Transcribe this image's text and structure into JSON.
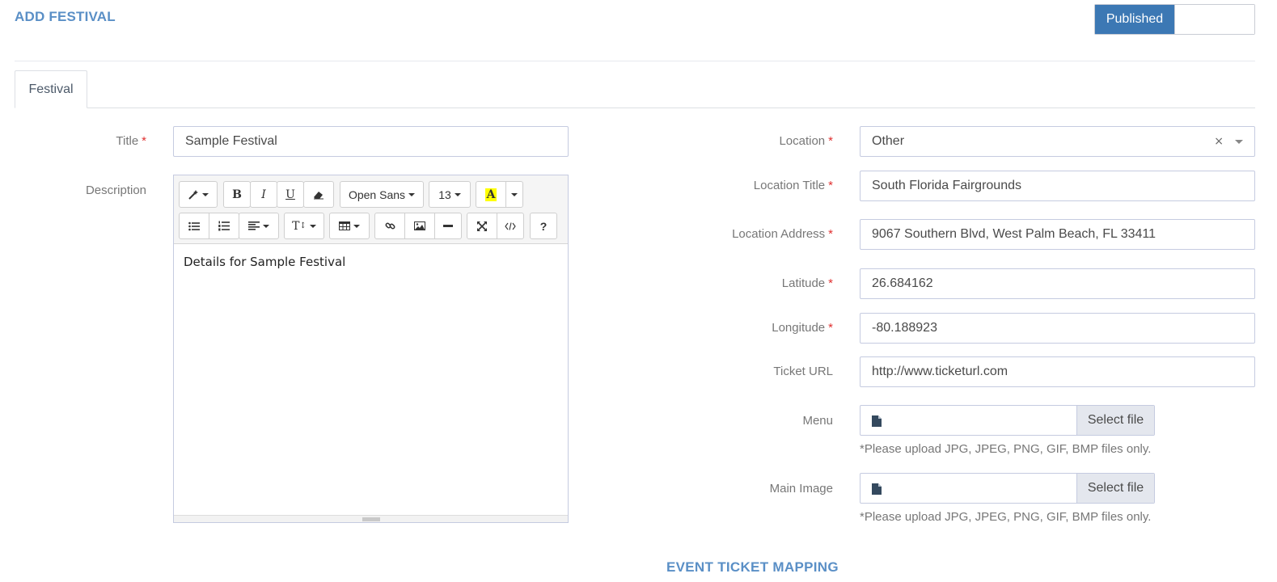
{
  "header": {
    "title": "ADD FESTIVAL"
  },
  "status_toggle": {
    "label": "Published",
    "accent": "#3c78b4"
  },
  "tabs": [
    {
      "label": "Festival"
    }
  ],
  "form": {
    "title": {
      "label": "Title",
      "required": "*",
      "value": "Sample Festival"
    },
    "description": {
      "label": "Description",
      "content": "Details for Sample Festival",
      "toolbar": {
        "font_family": "Open Sans",
        "font_size": "13",
        "bold": "B",
        "italic": "I",
        "underline": "U",
        "highlight": "A",
        "line_height": "T",
        "help": "?"
      }
    },
    "location": {
      "label": "Location",
      "required": "*",
      "value": "Other",
      "clear": "×"
    },
    "location_title": {
      "label": "Location Title",
      "required": "*",
      "value": "South Florida Fairgrounds"
    },
    "location_address": {
      "label": "Location Address",
      "required": "*",
      "value": "9067 Southern Blvd, West Palm Beach, FL 33411"
    },
    "latitude": {
      "label": "Latitude",
      "required": "*",
      "value": "26.684162"
    },
    "longitude": {
      "label": "Longitude",
      "required": "*",
      "value": "-80.188923"
    },
    "ticket_url": {
      "label": "Ticket URL",
      "value": "http://www.ticketurl.com"
    },
    "menu": {
      "label": "Menu",
      "button": "Select file",
      "hint": "*Please upload JPG, JPEG, PNG, GIF, BMP files only."
    },
    "main_image": {
      "label": "Main Image",
      "button": "Select file",
      "hint": "*Please upload JPG, JPEG, PNG, GIF, BMP files only."
    }
  },
  "sections": {
    "event_ticket_mapping": "EVENT TICKET MAPPING"
  },
  "colors": {
    "heading": "#5a8fc6",
    "required": "#e03030",
    "border": "#c5cbe0",
    "highlight_yellow": "#ffff00"
  }
}
